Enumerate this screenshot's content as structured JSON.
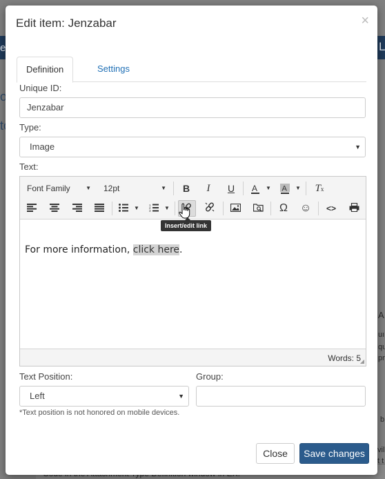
{
  "background": {
    "fragments": [
      "e",
      "L",
      "ol",
      "to",
      "A",
      "uı",
      "qu",
      "pr",
      "b",
      "vill",
      "t t",
      "Code in the Attachment Type Definition window in EX."
    ]
  },
  "modal": {
    "title": "Edit item: Jenzabar",
    "close_glyph": "×",
    "tabs": [
      {
        "label": "Definition",
        "active": true
      },
      {
        "label": "Settings",
        "active": false
      }
    ],
    "unique_id": {
      "label": "Unique ID:",
      "value": "Jenzabar"
    },
    "type": {
      "label": "Type:",
      "selected": "Image"
    },
    "text": {
      "label": "Text:",
      "toolbar": {
        "font_family": "Font Family",
        "font_size": "12pt",
        "tooltip": "Insert/edit link"
      },
      "content_before": "For more information, ",
      "content_link": "click here",
      "content_after": ".",
      "word_count": "Words: 5"
    },
    "text_position": {
      "label": "Text Position:",
      "selected": "Left"
    },
    "group": {
      "label": "Group:",
      "value": ""
    },
    "note": "*Text position is not honored on mobile devices.",
    "buttons": {
      "close": "Close",
      "save": "Save changes"
    }
  },
  "colors": {
    "primary": "#2b5b8c",
    "link": "#1f6fb5",
    "header_bg": "#1f3a5a"
  }
}
